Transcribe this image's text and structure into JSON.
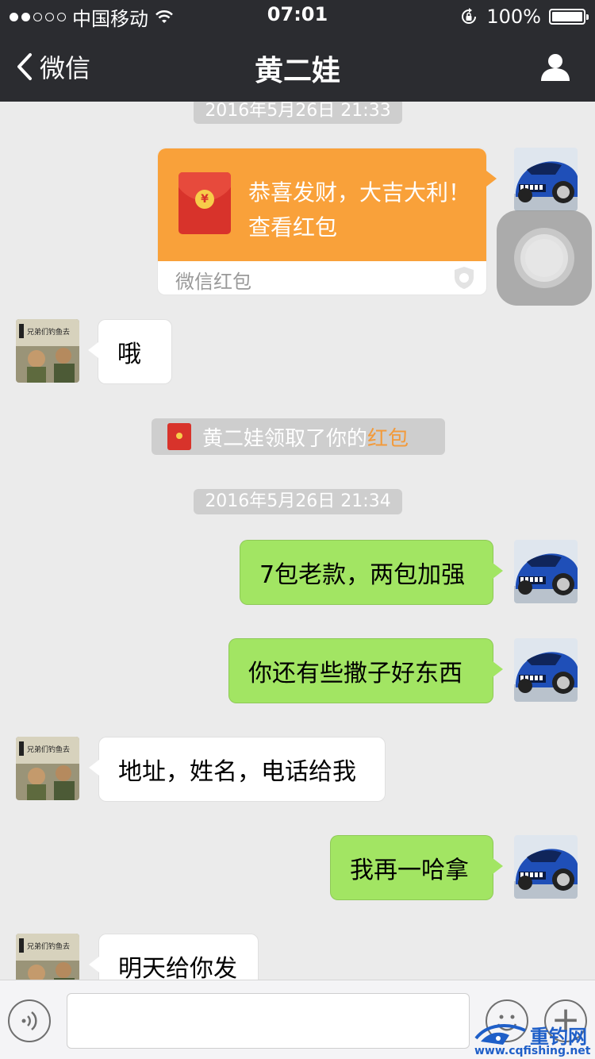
{
  "status_bar": {
    "carrier": "中国移动",
    "time": "07:01",
    "battery": "100%"
  },
  "nav": {
    "back_label": "微信",
    "title": "黄二娃"
  },
  "messages": {
    "ts1": "2016年5月26日 21:33",
    "red_packet": {
      "greeting": "恭喜发财，大吉大利！",
      "action": "查看红包",
      "footer": "微信红包"
    },
    "m_oh": "哦",
    "notice": {
      "prefix": "黄二娃领取了你的",
      "highlight": "红包"
    },
    "ts2": "2016年5月26日 21:34",
    "m1": "7包老款，两包加强",
    "m2": "你还有些撒子好东西",
    "m3": "地址，姓名，电话给我",
    "m4": "我再一哈拿",
    "m5": "明天给你发"
  },
  "friend_avatar_caption": "兄弟们钓鱼去",
  "input": {
    "value": "",
    "placeholder": ""
  },
  "watermark": {
    "name": "重钓网",
    "url": "www.cqfishing.net"
  },
  "colors": {
    "nav_bg": "#2b2c30",
    "chat_bg": "#ebebeb",
    "my_bubble": "#a2e563",
    "friend_bubble": "#ffffff",
    "red_packet": "#f9a13a",
    "highlight": "#f39a3a"
  }
}
